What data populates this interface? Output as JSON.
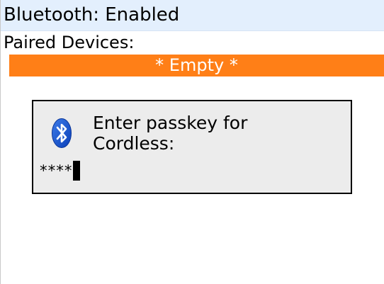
{
  "title_bar": {
    "text": "Bluetooth: Enabled",
    "background": "#e3effd"
  },
  "paired_devices": {
    "label": "Paired Devices:",
    "items": [
      "* Empty *"
    ],
    "highlight_color": "#ff7f17"
  },
  "passkey_dialog": {
    "icon": "bluetooth-icon",
    "message_line1": "Enter passkey for",
    "message_line2": "Cordless:",
    "passkey_value": "****"
  }
}
